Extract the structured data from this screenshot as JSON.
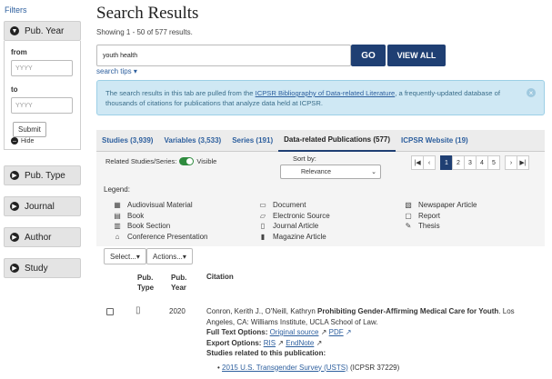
{
  "sidebar": {
    "title": "Filters",
    "facets": [
      {
        "label": "Pub. Year"
      },
      {
        "label": "Pub. Type"
      },
      {
        "label": "Journal"
      },
      {
        "label": "Author"
      },
      {
        "label": "Study"
      }
    ],
    "from_label": "from",
    "to_label": "to",
    "from_placeholder": "YYYY",
    "to_placeholder": "YYYY",
    "submit_label": "Submit",
    "hide_label": "Hide"
  },
  "main": {
    "title": "Search Results",
    "showing": "Showing 1 - 50 of 577 results.",
    "search_value": "youth health",
    "go_label": "GO",
    "view_all_label": "VIEW ALL",
    "search_tips": "search tips ▾",
    "info_pre": "The search results in this tab are pulled from the ",
    "info_link": "ICPSR Bibliography of Data-related Literature",
    "info_post": ", a frequently-updated database of thousands of citations for publications that analyze data held at ICPSR.",
    "tabs": [
      {
        "label": "Studies (3,939)"
      },
      {
        "label": "Variables (3,533)"
      },
      {
        "label": "Series (191)"
      },
      {
        "label": "Data-related Publications (577)"
      },
      {
        "label": "ICPSR Website (19)"
      }
    ],
    "related_label": "Related Studies/Series:",
    "visible_label": "Visible",
    "sort_label": "Sort by:",
    "sort_value": "Relevance",
    "pages": [
      "1",
      "2",
      "3",
      "4",
      "5"
    ],
    "legend_title": "Legend:",
    "legend": [
      {
        "label": "Audiovisual Material"
      },
      {
        "label": "Book"
      },
      {
        "label": "Book Section"
      },
      {
        "label": "Conference Presentation"
      },
      {
        "label": "Document"
      },
      {
        "label": "Electronic Source"
      },
      {
        "label": "Journal Article"
      },
      {
        "label": "Magazine Article"
      },
      {
        "label": "Newspaper Article"
      },
      {
        "label": "Report"
      },
      {
        "label": "Thesis"
      }
    ],
    "select_label": "Select...▾",
    "actions_label": "Actions...▾",
    "col_pub_type_1": "Pub.",
    "col_pub_type_2": "Type",
    "col_pub_year_1": "Pub.",
    "col_pub_year_2": "Year",
    "col_citation": "Citation",
    "result": {
      "year": "2020",
      "authors": "Conron, Kerith J., O'Neill, Kathryn ",
      "title": "Prohibiting Gender-Affirming Medical Care for Youth",
      "place": ". Los Angeles, CA: Williams Institute, UCLA School of Law.",
      "full_text_label": "Full Text Options:",
      "original_source": "Original source",
      "pdf": "PDF",
      "export_label": "Export Options:",
      "ris": "RIS",
      "endnote": "EndNote",
      "studies_label": "Studies related to this publication:",
      "study_link": "2015 U.S. Transgender Survey (USTS)",
      "study_id": " (ICPSR 37229)"
    }
  }
}
